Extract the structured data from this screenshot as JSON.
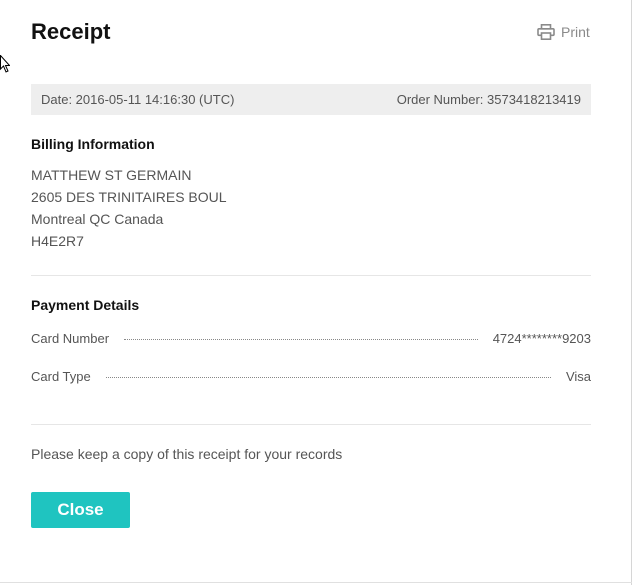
{
  "receipt": {
    "title": "Receipt",
    "print_label": "Print",
    "date_text": "Date: 2016-05-11 14:16:30 (UTC)",
    "order_text": "Order Number: 3573418213419"
  },
  "billing": {
    "heading": "Billing Information",
    "lines": [
      "MATTHEW ST GERMAIN",
      "2605 DES TRINITAIRES BOUL",
      "Montreal QC Canada",
      "H4E2R7"
    ]
  },
  "payment": {
    "heading": "Payment Details",
    "rows": [
      {
        "label": "Card Number",
        "value": "4724********9203"
      },
      {
        "label": "Card Type",
        "value": "Visa"
      }
    ]
  },
  "footer": {
    "note": "Please keep a copy of this receipt for your records",
    "close_label": "Close"
  },
  "colors": {
    "accent": "#1fc4c0",
    "info_bar_background": "#eeeeee",
    "text": "#555555",
    "heading": "#111111"
  },
  "icons": [
    "print-icon",
    "mouse-pointer-icon"
  ]
}
